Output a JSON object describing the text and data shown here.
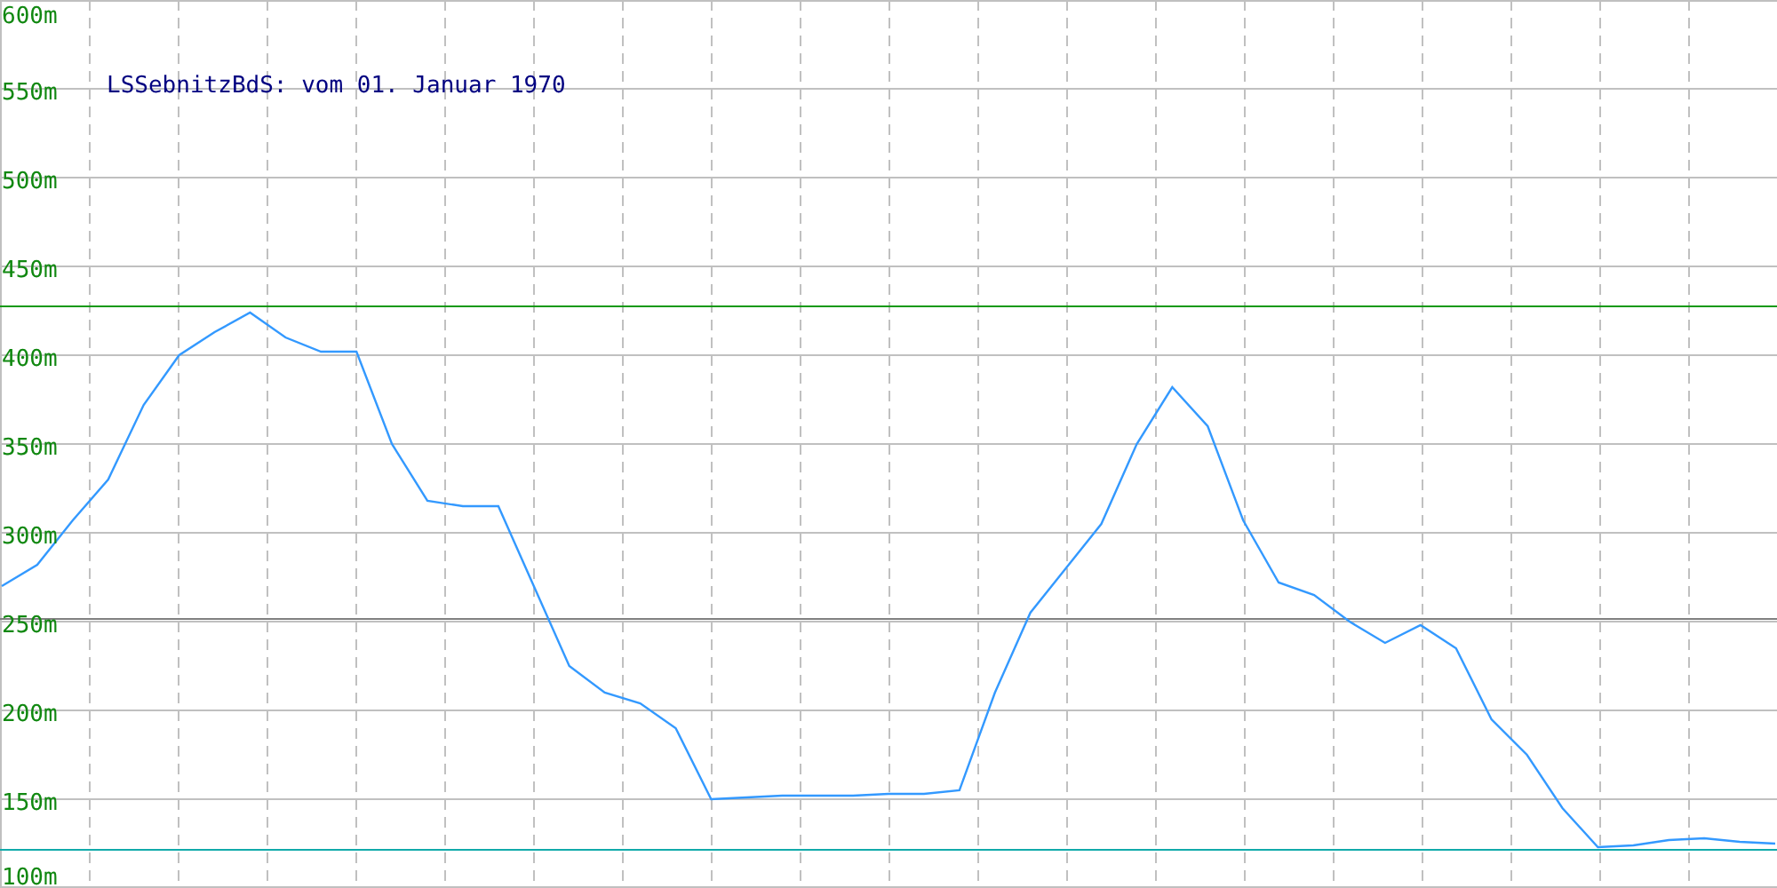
{
  "chart_data": {
    "type": "line",
    "title": "LSSebnitzBdS: vom 01. Januar 1970",
    "grid": true,
    "series": [
      {
        "color": "#3399ff",
        "values": [
          270,
          282,
          307,
          330,
          372,
          400,
          413,
          424,
          410,
          402,
          402,
          350,
          318,
          315,
          315,
          270,
          225,
          210,
          204,
          190,
          150,
          151,
          152,
          152,
          152,
          153,
          153,
          155,
          210,
          255,
          280,
          305,
          350,
          382,
          360,
          307,
          272,
          265,
          250,
          238,
          248,
          235,
          195,
          175,
          145,
          123,
          124,
          127,
          128,
          126,
          125
        ]
      }
    ],
    "ylim": [
      100,
      600
    ],
    "yticks": [
      {
        "value": 100,
        "label": "100m"
      },
      {
        "value": 150,
        "label": "150m"
      },
      {
        "value": 200,
        "label": "200m"
      },
      {
        "value": 250,
        "label": "250m"
      },
      {
        "value": 300,
        "label": "300m"
      },
      {
        "value": 350,
        "label": "350m"
      },
      {
        "value": 400,
        "label": "400m"
      },
      {
        "value": 450,
        "label": "450m"
      },
      {
        "value": 500,
        "label": "500m"
      },
      {
        "value": 550,
        "label": "550m"
      },
      {
        "value": 600,
        "label": "600m"
      }
    ],
    "ref_lines": [
      {
        "axis": "y",
        "value": 428,
        "color": "#119911"
      },
      {
        "axis": "y",
        "value": 252,
        "color": "#808080"
      },
      {
        "axis": "y",
        "value": 122,
        "color": "#11aaaa"
      }
    ]
  }
}
